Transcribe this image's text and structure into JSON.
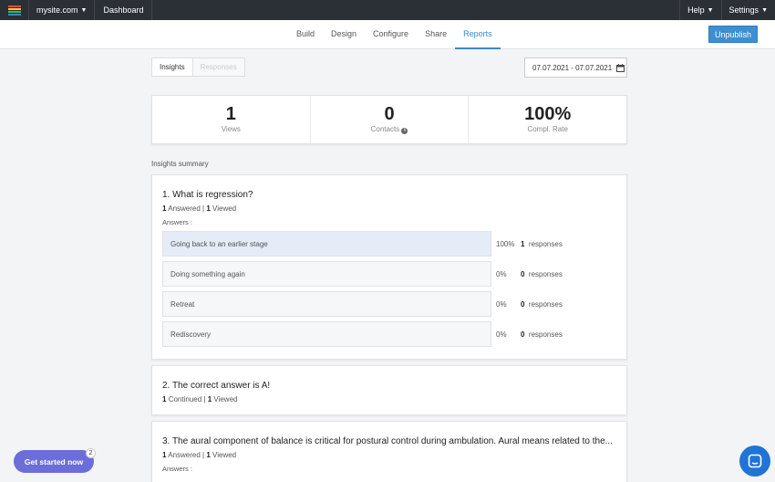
{
  "topbar": {
    "logo_colors": [
      "#e84a3c",
      "#f4c542",
      "#3fb950",
      "#3b88c8"
    ],
    "site": "mysite.com",
    "dashboard": "Dashboard",
    "help": "Help",
    "settings": "Settings"
  },
  "nav": {
    "tabs": [
      "Build",
      "Design",
      "Configure",
      "Share",
      "Reports"
    ],
    "active_tab": "Reports",
    "unpublish": "Unpublish"
  },
  "toggle": {
    "insights": "Insights",
    "responses": "Responses"
  },
  "date_range": "07.07.2021 - 07.07.2021",
  "stats": [
    {
      "value": "1",
      "label": "Views"
    },
    {
      "value": "0",
      "label": "Contacts"
    },
    {
      "value": "100%",
      "label": "Compl. Rate"
    }
  ],
  "summary_title": "Insights summary",
  "questions": [
    {
      "title": "1. What is regression?",
      "meta_count_1": "1",
      "meta_label_1": "Answered",
      "meta_count_2": "1",
      "meta_label_2": "Viewed",
      "answers_label": "Answers :",
      "answers": [
        {
          "text": "Going back to an earlier stage",
          "pct": "100%",
          "count": "1",
          "resp_label": "responses",
          "fraction": 1.0
        },
        {
          "text": "Doing something again",
          "pct": "0%",
          "count": "0",
          "resp_label": "responses",
          "fraction": 0
        },
        {
          "text": "Retreat",
          "pct": "0%",
          "count": "0",
          "resp_label": "responses",
          "fraction": 0
        },
        {
          "text": "Rediscovery",
          "pct": "0%",
          "count": "0",
          "resp_label": "responses",
          "fraction": 0
        }
      ]
    },
    {
      "title": "2. The correct answer is A!",
      "meta_count_1": "1",
      "meta_label_1": "Continued",
      "meta_count_2": "1",
      "meta_label_2": "Viewed"
    },
    {
      "title": "3. The aural component of balance is critical for postural control during ambulation. Aural means related to the...",
      "meta_count_1": "1",
      "meta_label_1": "Answered",
      "meta_count_2": "1",
      "meta_label_2": "Viewed",
      "answers_label": "Answers :"
    }
  ],
  "get_started": "Get started now",
  "get_started_badge": "2"
}
